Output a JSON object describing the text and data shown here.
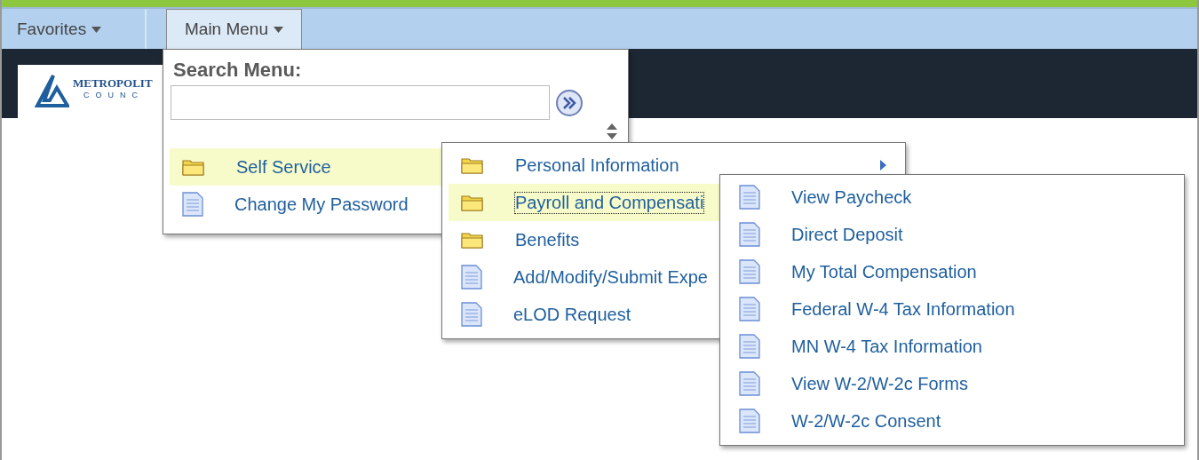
{
  "nav": {
    "tabs": [
      {
        "label": "Favorites",
        "selected": false
      },
      {
        "label": "Main Menu",
        "selected": true
      }
    ]
  },
  "logo": {
    "line_1": "METROPOLIT",
    "line_2": "COUNC"
  },
  "search": {
    "label": "Search Menu:"
  },
  "menus": [
    {
      "items": [
        {
          "label": "Self Service",
          "kind": "folder",
          "selected": true,
          "arrow": false
        },
        {
          "label": "Change My Password",
          "kind": "page",
          "selected": false,
          "arrow": false
        }
      ]
    },
    {
      "items": [
        {
          "label": "Personal Information",
          "kind": "folder",
          "selected": false,
          "arrow": true
        },
        {
          "label": "Payroll and Compensati",
          "kind": "folder",
          "selected": true,
          "arrow": false
        },
        {
          "label": "Benefits",
          "kind": "folder",
          "selected": false,
          "arrow": false
        },
        {
          "label": "Add/Modify/Submit Expe",
          "kind": "page",
          "selected": false,
          "arrow": false
        },
        {
          "label": "eLOD Request",
          "kind": "page",
          "selected": false,
          "arrow": false
        }
      ]
    },
    {
      "items": [
        {
          "label": "View Paycheck",
          "kind": "page",
          "selected": false,
          "arrow": false
        },
        {
          "label": "Direct Deposit",
          "kind": "page",
          "selected": false,
          "arrow": false
        },
        {
          "label": "My Total Compensation",
          "kind": "page",
          "selected": false,
          "arrow": false
        },
        {
          "label": "Federal W-4 Tax Information",
          "kind": "page",
          "selected": false,
          "arrow": false
        },
        {
          "label": "MN W-4 Tax Information",
          "kind": "page",
          "selected": false,
          "arrow": false
        },
        {
          "label": "View W-2/W-2c Forms",
          "kind": "page",
          "selected": false,
          "arrow": false
        },
        {
          "label": "W-2/W-2c Consent",
          "kind": "page",
          "selected": false,
          "arrow": false
        }
      ]
    }
  ]
}
